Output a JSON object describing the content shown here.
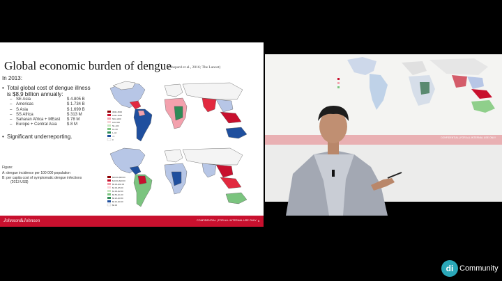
{
  "slide": {
    "title": "Global economic burden of dengue",
    "citation": "(Shepard et al., 2016; The Lancet)",
    "intro": "In 2013:",
    "bullet1_line1": "Total global cost of dengue illness",
    "bullet1_line2": "is $8.9 billion annually:",
    "regions": [
      {
        "name": "SE Asia",
        "value": "$ 4.805 B"
      },
      {
        "name": "Americas",
        "value": "$ 1.734 B"
      },
      {
        "name": "S Asia",
        "value": "$ 1.699 B"
      },
      {
        "name": "SS Africa",
        "value": "$    313 M"
      },
      {
        "name": "Saharan Africa + MEast",
        "value": "$      78 M"
      },
      {
        "name": "Europe  + Central Asia",
        "value": "$        8 M"
      }
    ],
    "bullet2": "Significant underreporting.",
    "figure_label": "Figure:",
    "figure_a": "A:   dengue incidence per 100 000 population",
    "figure_b": "B:   per capita cost of symptomatic dengue infections",
    "figure_b2": "(2013 US$)",
    "legend_top": [
      "3000–5000",
      "1000–3000",
      "500–1000",
      "100–500",
      "50–100",
      "10–50",
      "1–10",
      "<1",
      "0"
    ],
    "legend_bottom": [
      "$20.00–$50.00",
      "$10.00–$20.00",
      "$5.00–$10.00",
      "$2.00–$5.00",
      "$1.00–$2.00",
      "$0.50–$1.00",
      "$0.20–$0.50",
      "$0.10–$0.20",
      "$0.00"
    ],
    "footer_logo": "Johnson&Johnson",
    "footer_confidential": "CONFIDENTIAL  |  FOR ALL INTERNAL USE ONLY",
    "page_number": "5"
  },
  "screen": {
    "footer_text": "CONFIDENTIAL  |  FOR ALL INTERNAL USE ONLY"
  },
  "brand": {
    "logo_letters": "di",
    "name": "Community"
  }
}
